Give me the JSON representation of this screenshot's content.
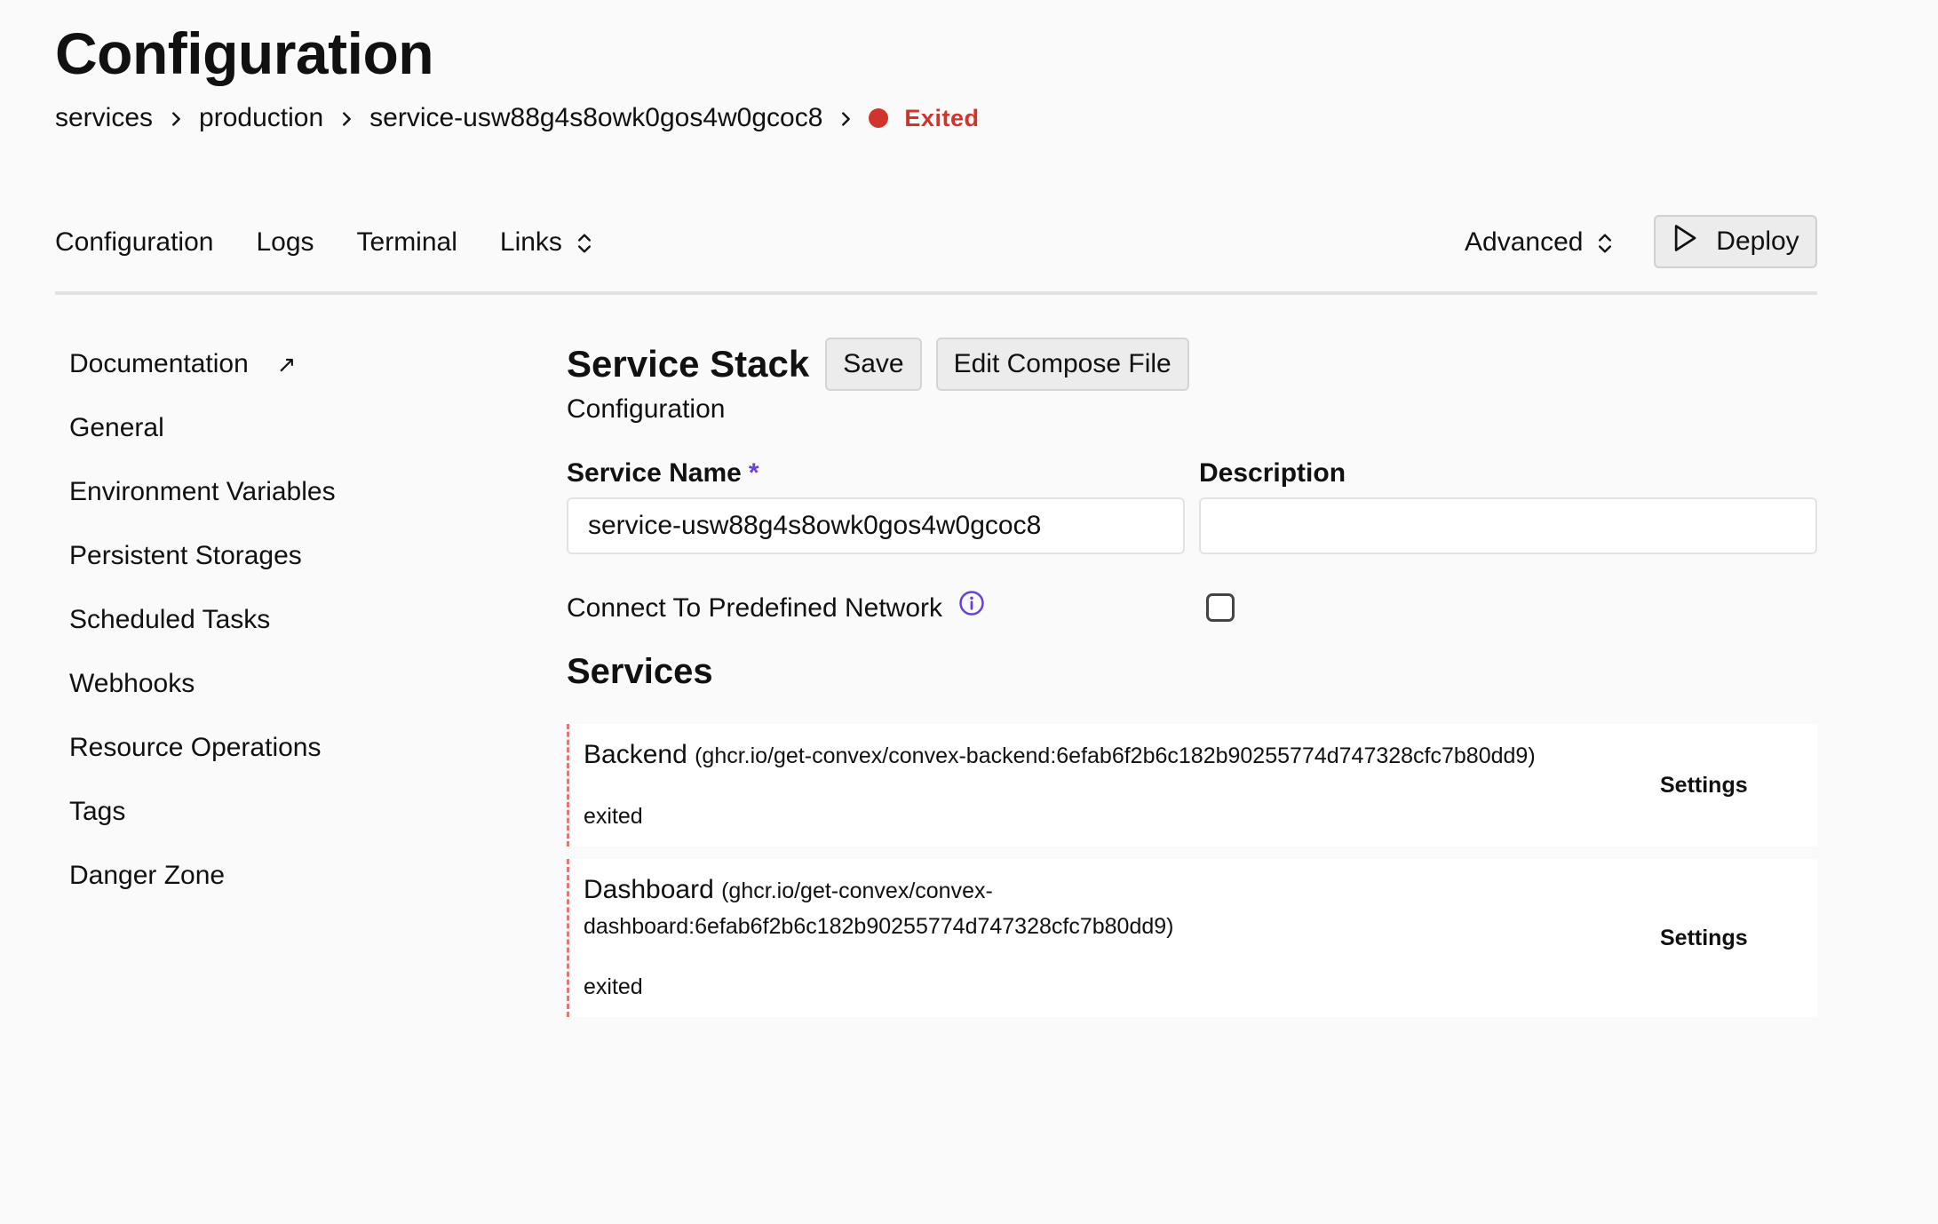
{
  "page": {
    "title": "Configuration"
  },
  "breadcrumb": {
    "items": [
      "services",
      "production",
      "service-usw88g4s8owk0gos4w0gcoc8"
    ],
    "status": "Exited",
    "status_color": "#d0342c"
  },
  "nav": {
    "tabs": [
      "Configuration",
      "Logs",
      "Terminal",
      "Links"
    ],
    "advanced_label": "Advanced",
    "deploy_label": "Deploy"
  },
  "sidebar": {
    "items": [
      {
        "label": "Documentation",
        "external": "↗"
      },
      {
        "label": "General"
      },
      {
        "label": "Environment Variables"
      },
      {
        "label": "Persistent Storages"
      },
      {
        "label": "Scheduled Tasks"
      },
      {
        "label": "Webhooks"
      },
      {
        "label": "Resource Operations"
      },
      {
        "label": "Tags"
      },
      {
        "label": "Danger Zone"
      }
    ]
  },
  "main": {
    "title": "Service Stack",
    "save_label": "Save",
    "edit_compose_label": "Edit Compose File",
    "subtitle": "Configuration",
    "service_name_label": "Service Name",
    "required_mark": "*",
    "service_name_value": "service-usw88g4s8owk0gos4w0gcoc8",
    "description_label": "Description",
    "description_value": "",
    "network_label": "Connect To Predefined Network",
    "network_checked": false,
    "services_title": "Services",
    "accent_color": "#6b3fd9"
  },
  "services": [
    {
      "name": "Backend",
      "image": "(ghcr.io/get-convex/convex-backend:6efab6f2b6c182b90255774d747328cfc7b80dd9)",
      "status": "exited",
      "settings_label": "Settings"
    },
    {
      "name": "Dashboard",
      "image_line1": "(ghcr.io/get-convex/convex-",
      "image_line2": "dashboard:6efab6f2b6c182b90255774d747328cfc7b80dd9)",
      "status": "exited",
      "settings_label": "Settings"
    }
  ]
}
